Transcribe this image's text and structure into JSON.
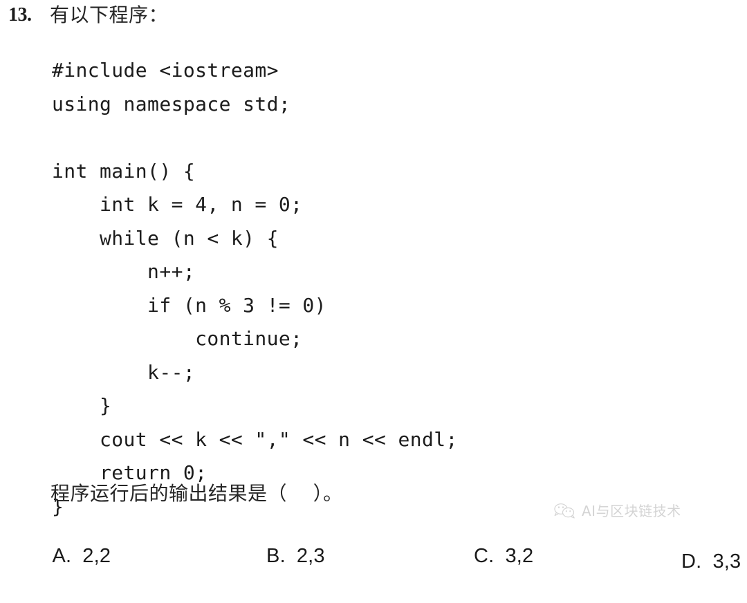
{
  "question": {
    "number": "13.",
    "stem": "有以下程序：",
    "prompt": "程序运行后的输出结果是（    ）。"
  },
  "code": {
    "language": "cpp",
    "lines": [
      "#include <iostream>",
      "using namespace std;",
      "",
      "int main() {",
      "    int k = 4, n = 0;",
      "    while (n < k) {",
      "        n++;",
      "        if (n % 3 != 0)",
      "            continue;",
      "        k--;",
      "    }",
      "    cout << k << \",\" << n << endl;",
      "    return 0;",
      "}"
    ]
  },
  "options": [
    {
      "letter": "A.",
      "text": "2,2"
    },
    {
      "letter": "B.",
      "text": "2,3"
    },
    {
      "letter": "C.",
      "text": "3,2"
    },
    {
      "letter": "D.",
      "text": "3,3"
    }
  ],
  "watermark": {
    "icon": "wechat-bubbles-icon",
    "text": "AI与区块链技术",
    "color": "#9a9a9a"
  }
}
